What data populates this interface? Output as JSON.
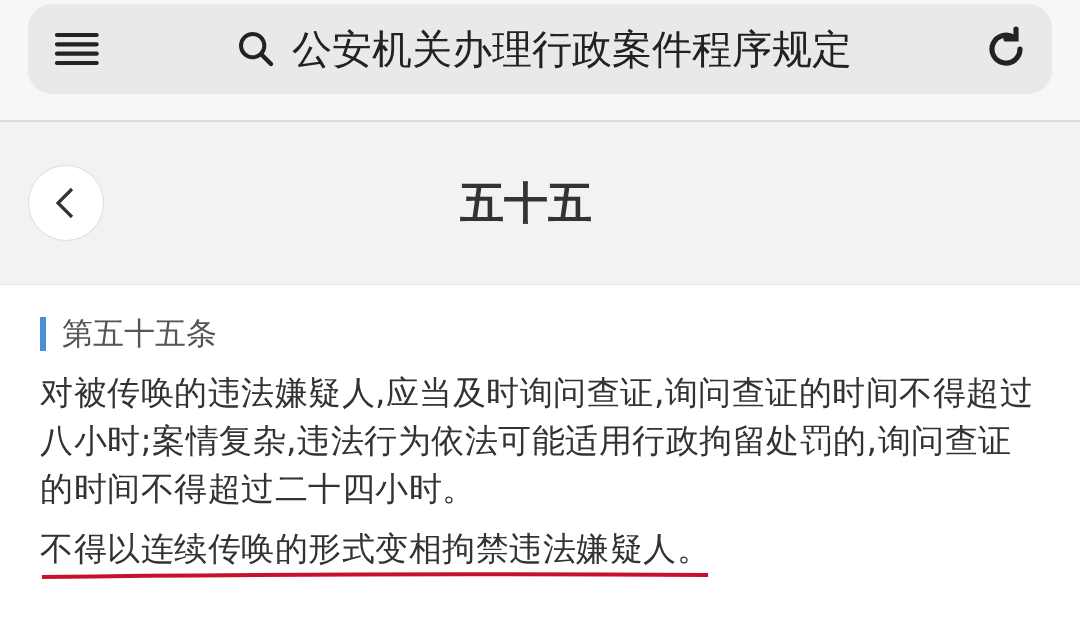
{
  "search_bar": {
    "query": "公安机关办理行政案件程序规定"
  },
  "header": {
    "title": "五十五"
  },
  "article": {
    "heading": "第五十五条",
    "paragraphs": [
      {
        "text": "对被传唤的违法嫌疑人,应当及时询问查证,询问查证的时间不得超过八小时;案情复杂,违法行为依法可能适用行政拘留处罚的,询问查证的时间不得超过二十四小时。",
        "underlined": false
      },
      {
        "text": "不得以连续传唤的形式变相拘禁违法嫌疑人。",
        "underlined": true
      }
    ]
  }
}
